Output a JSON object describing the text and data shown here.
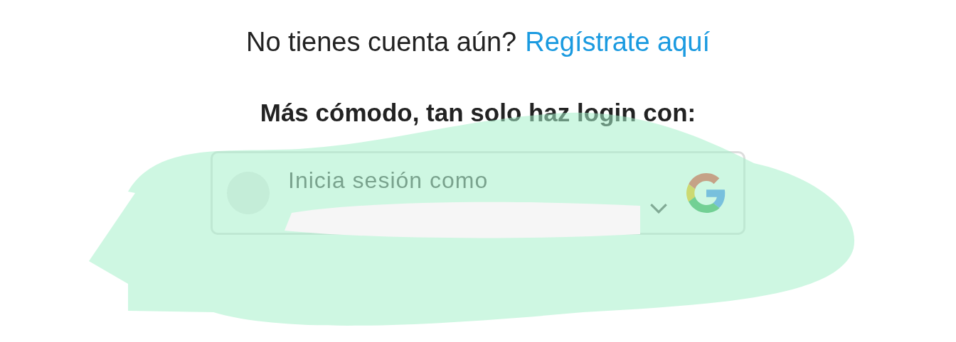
{
  "signup_prompt": {
    "text": "No tienes cuenta aún?",
    "link": "Regístrate aquí"
  },
  "heading": "Más cómodo, tan solo haz login con:",
  "google_account_button": {
    "label": "Inicia sesión como"
  }
}
